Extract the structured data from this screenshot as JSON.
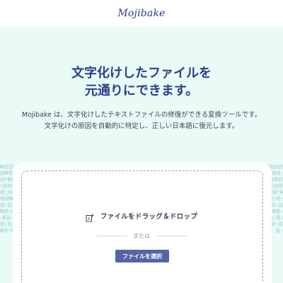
{
  "header": {
    "logo": "Mojibake"
  },
  "hero": {
    "headline_line1": "文字化けしたファイルを",
    "headline_line2": "元通りにできます。",
    "subtitle_line1": "Mojibake は、文字化けしたテキストファイルの修復ができる変換ツールです。",
    "subtitle_line2": "文字化けの原因を自動的に特定し、正しい日本語に復元します。"
  },
  "background_text": {
    "left": "�繧謎縺�蜀縺ｹ�繝ｼ閾蜍�縺ｪ譁ｭ蠎縺�蜿ｯ閭ｽ�縺ｧ繧ｯ�蝨ｰ繝ｬ髢ｲ�縺ｩ繧",
    "right": "閾蜍縺ｪ�譁ｭ蠎�縺繧謎縺蜀縺ｹ�繝ｼ縺ｧ�繧ｯ蝨ｰ�繝ｬ蜿ｯ閭ｽ�縺ｩ繧髢ｲ"
  },
  "dropzone": {
    "icon": "file-add-icon",
    "label": "ファイルをドラッグ＆ドロップ",
    "or_text": "または",
    "button_label": "ファイルを選択"
  },
  "colors": {
    "accent": "#5564a8",
    "headline": "#2f3d8b",
    "hero_bg": "#e9faf7",
    "dashed_border": "#8fa2c9"
  }
}
